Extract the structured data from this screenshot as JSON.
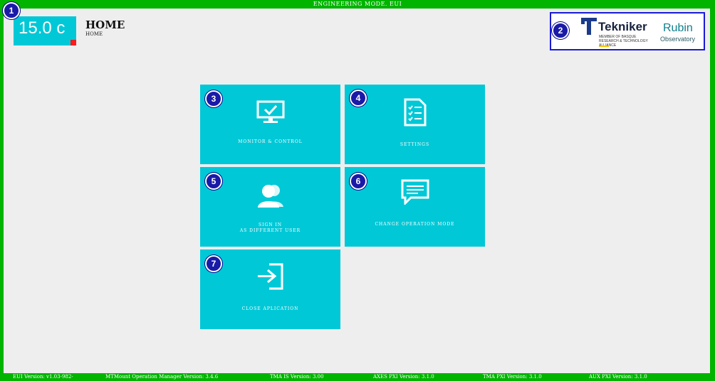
{
  "window": {
    "title": "ENGINEERING MODE. EUI"
  },
  "temperature": {
    "value": "15.0 c",
    "alarm_color": "#ff1a1a"
  },
  "header": {
    "title": "HOME",
    "breadcrumb": "HOME"
  },
  "logos": {
    "tekniker": {
      "name": "Tekniker",
      "tagline": "MEMBER OF BASQUE RESEARCH & TECHNOLOGY ALLIANCE"
    },
    "rubin": {
      "name": "Rubin",
      "sub": "Observatory"
    }
  },
  "tiles": [
    {
      "label": "MONITOR & CONTROL",
      "icon": "monitor-check-icon"
    },
    {
      "label": "SETTINGS",
      "icon": "checklist-document-icon"
    },
    {
      "label": "SIGN IN\nAS DIFFERENT USER",
      "icon": "users-icon"
    },
    {
      "label": "CHANGE OPERATION MODE",
      "icon": "chat-message-icon"
    },
    {
      "label": "CLOSE APLICATION",
      "icon": "sign-in-arrow-icon"
    }
  ],
  "badges": [
    "1",
    "2",
    "3",
    "4",
    "5",
    "6",
    "7"
  ],
  "footer": {
    "eui": "EUI Version: v1.03-982-",
    "mtmount": "MTMount Operation Manager Version: 3.4.6",
    "tma_is": "TMA IS Version: 3.00",
    "axes_pxi": "AXES PXI Version: 3.1.0",
    "tma_pxi": "TMA PXI Version: 3.1.0",
    "aux_pxi": "AUX PXI Version: 3.1.0"
  },
  "colors": {
    "frame": "#00b400",
    "tile": "#00c8d7",
    "background": "#eeeeee",
    "badge": "#1a1aa8"
  }
}
